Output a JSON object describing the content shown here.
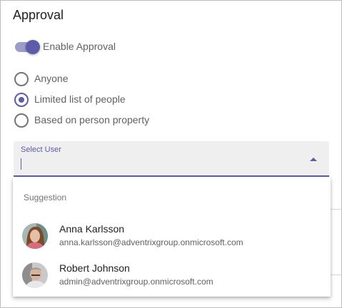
{
  "panel": {
    "title": "Approval"
  },
  "toggle": {
    "label": "Enable Approval",
    "enabled": true
  },
  "radios": [
    {
      "label": "Anyone",
      "checked": false
    },
    {
      "label": "Limited list of people",
      "checked": true
    },
    {
      "label": "Based on person property",
      "checked": false
    }
  ],
  "select": {
    "label": "Select User",
    "value": ""
  },
  "suggestions": {
    "header": "Suggestion",
    "people": [
      {
        "name": "Anna Karlsson",
        "email": "anna.karlsson@adventrixgroup.onmicrosoft.com",
        "avatar": "female-avatar-photo"
      },
      {
        "name": "Robert Johnson",
        "email": "admin@adventrixgroup.onmicrosoft.com",
        "avatar": "male-avatar-photo"
      }
    ]
  },
  "colors": {
    "accent": "#5c5ca8",
    "track": "#9c9ccc",
    "field_bg": "#efefef"
  }
}
